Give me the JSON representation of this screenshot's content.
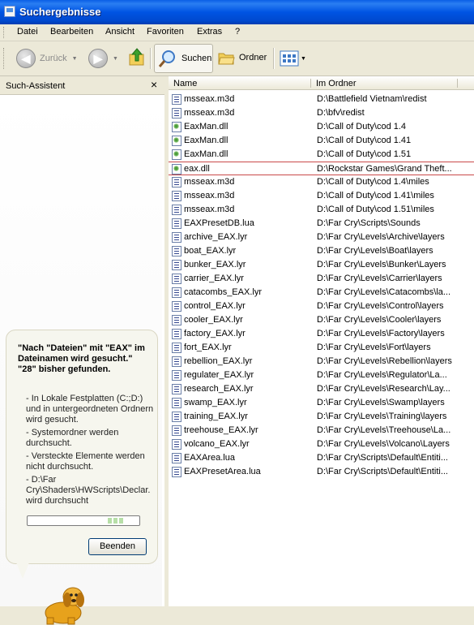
{
  "window": {
    "title": "Suchergebnisse"
  },
  "menu": [
    "Datei",
    "Bearbeiten",
    "Ansicht",
    "Favoriten",
    "Extras",
    "?"
  ],
  "toolbar": {
    "back_label": "Zurück",
    "search_label": "Suchen",
    "folders_label": "Ordner"
  },
  "left_panel": {
    "title": "Such-Assistent",
    "close_glyph": "×",
    "bubble_headline": "\"Nach \"Dateien\" mit \"EAX\" im Dateinamen wird gesucht.\"  \"28\" bisher gefunden.",
    "status_items": [
      "- In Lokale Festplatten (C:;D:) und in untergeordneten Ordnern wird gesucht.",
      "- Systemordner werden durchsucht.",
      "- Versteckte Elemente werden nicht durchsucht.",
      "- D:\\Far Cry\\Shaders\\HWScripts\\Declar. wird durchsucht"
    ],
    "stop_button": "Beenden"
  },
  "columns": {
    "name": "Name",
    "folder": "Im Ordner"
  },
  "files": [
    {
      "name": "msseax.m3d",
      "folder": "D:\\Battlefield Vietnam\\redist",
      "icon": "document-icon"
    },
    {
      "name": "msseax.m3d",
      "folder": "D:\\bfv\\redist",
      "icon": "document-icon"
    },
    {
      "name": "EaxMan.dll",
      "folder": "D:\\Call of Duty\\cod 1.4",
      "icon": "dll-icon"
    },
    {
      "name": "EaxMan.dll",
      "folder": "D:\\Call of Duty\\cod 1.41",
      "icon": "dll-icon"
    },
    {
      "name": "EaxMan.dll",
      "folder": "D:\\Call of Duty\\cod 1.51",
      "icon": "dll-icon"
    },
    {
      "name": "eax.dll",
      "folder": "D:\\Rockstar Games\\Grand Theft...",
      "icon": "dll-icon",
      "selected": true
    },
    {
      "name": "msseax.m3d",
      "folder": "D:\\Call of Duty\\cod 1.4\\miles",
      "icon": "document-icon"
    },
    {
      "name": "msseax.m3d",
      "folder": "D:\\Call of Duty\\cod 1.41\\miles",
      "icon": "document-icon"
    },
    {
      "name": "msseax.m3d",
      "folder": "D:\\Call of Duty\\cod 1.51\\miles",
      "icon": "document-icon"
    },
    {
      "name": "EAXPresetDB.lua",
      "folder": "D:\\Far Cry\\Scripts\\Sounds",
      "icon": "document-icon"
    },
    {
      "name": "archive_EAX.lyr",
      "folder": "D:\\Far Cry\\Levels\\Archive\\layers",
      "icon": "document-icon"
    },
    {
      "name": "boat_EAX.lyr",
      "folder": "D:\\Far Cry\\Levels\\Boat\\layers",
      "icon": "document-icon"
    },
    {
      "name": "bunker_EAX.lyr",
      "folder": "D:\\Far Cry\\Levels\\Bunker\\Layers",
      "icon": "document-icon"
    },
    {
      "name": "carrier_EAX.lyr",
      "folder": "D:\\Far Cry\\Levels\\Carrier\\layers",
      "icon": "document-icon"
    },
    {
      "name": "catacombs_EAX.lyr",
      "folder": "D:\\Far Cry\\Levels\\Catacombs\\la...",
      "icon": "document-icon"
    },
    {
      "name": "control_EAX.lyr",
      "folder": "D:\\Far Cry\\Levels\\Control\\layers",
      "icon": "document-icon"
    },
    {
      "name": "cooler_EAX.lyr",
      "folder": "D:\\Far Cry\\Levels\\Cooler\\layers",
      "icon": "document-icon"
    },
    {
      "name": "factory_EAX.lyr",
      "folder": "D:\\Far Cry\\Levels\\Factory\\layers",
      "icon": "document-icon"
    },
    {
      "name": "fort_EAX.lyr",
      "folder": "D:\\Far Cry\\Levels\\Fort\\layers",
      "icon": "document-icon"
    },
    {
      "name": "rebellion_EAX.lyr",
      "folder": "D:\\Far Cry\\Levels\\Rebellion\\layers",
      "icon": "document-icon"
    },
    {
      "name": "regulater_EAX.lyr",
      "folder": "D:\\Far Cry\\Levels\\Regulator\\La...",
      "icon": "document-icon"
    },
    {
      "name": "research_EAX.lyr",
      "folder": "D:\\Far Cry\\Levels\\Research\\Lay...",
      "icon": "document-icon"
    },
    {
      "name": "swamp_EAX.lyr",
      "folder": "D:\\Far Cry\\Levels\\Swamp\\layers",
      "icon": "document-icon"
    },
    {
      "name": "training_EAX.lyr",
      "folder": "D:\\Far Cry\\Levels\\Training\\layers",
      "icon": "document-icon"
    },
    {
      "name": "treehouse_EAX.lyr",
      "folder": "D:\\Far Cry\\Levels\\Treehouse\\La...",
      "icon": "document-icon"
    },
    {
      "name": "volcano_EAX.lyr",
      "folder": "D:\\Far Cry\\Levels\\Volcano\\Layers",
      "icon": "document-icon"
    },
    {
      "name": "EAXArea.lua",
      "folder": "D:\\Far Cry\\Scripts\\Default\\Entiti...",
      "icon": "document-icon"
    },
    {
      "name": "EAXPresetArea.lua",
      "folder": "D:\\Far Cry\\Scripts\\Default\\Entiti...",
      "icon": "document-icon"
    }
  ],
  "colors": {
    "title_bar": "#0054e3",
    "selection_border": "#c94a4a",
    "chrome": "#ece9d8"
  }
}
